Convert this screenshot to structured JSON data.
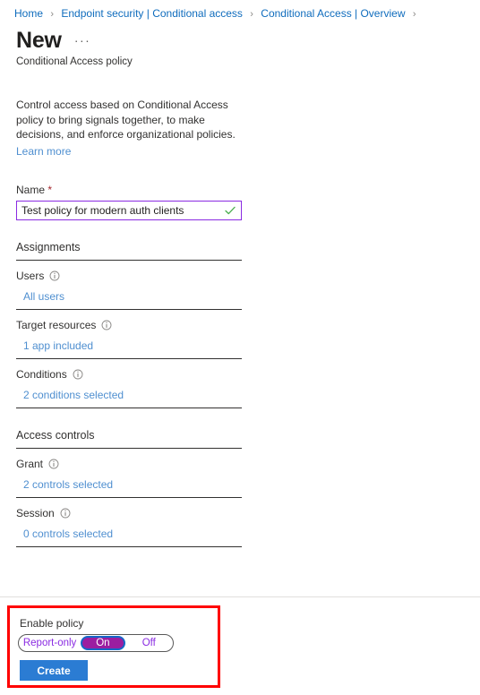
{
  "breadcrumb": {
    "separator": "›",
    "items": [
      {
        "label": "Home"
      },
      {
        "label": "Endpoint security | Conditional access"
      },
      {
        "label": "Conditional Access | Overview"
      }
    ]
  },
  "header": {
    "title": "New",
    "more_label": "···",
    "subtitle": "Conditional Access policy"
  },
  "intro": {
    "description": "Control access based on Conditional Access policy to bring signals together, to make decisions, and enforce organizational policies.",
    "learn_more": "Learn more"
  },
  "name_field": {
    "label": "Name",
    "required_marker": "*",
    "value": "Test policy for modern auth clients",
    "placeholder": "",
    "validation_icon": "checkmark-icon"
  },
  "assignments": {
    "heading": "Assignments",
    "rows": [
      {
        "label": "Users",
        "value": "All users",
        "info": "info-icon"
      },
      {
        "label": "Target resources",
        "value": "1 app included",
        "info": "info-icon"
      },
      {
        "label": "Conditions",
        "value": "2 conditions selected",
        "info": "info-icon"
      }
    ]
  },
  "access_controls": {
    "heading": "Access controls",
    "rows": [
      {
        "label": "Grant",
        "value": "2 controls selected",
        "info": "info-icon"
      },
      {
        "label": "Session",
        "value": "0 controls selected",
        "info": "info-icon"
      }
    ]
  },
  "footer": {
    "enable_label": "Enable policy",
    "toggle": {
      "options": [
        "Report-only",
        "On",
        "Off"
      ],
      "selected": "On"
    },
    "create_label": "Create"
  },
  "colors": {
    "link": "#4f8fd0",
    "breadcrumb_link": "#0f6cbd",
    "accent_purple": "#8a2be2",
    "toggle_on_fill": "#9b1ea0",
    "toggle_focus_ring": "#1567c8",
    "primary_button": "#2b7cd3",
    "highlight_box": "#ff0000",
    "required_star": "#a4262c",
    "validation_check": "#4caf50"
  }
}
